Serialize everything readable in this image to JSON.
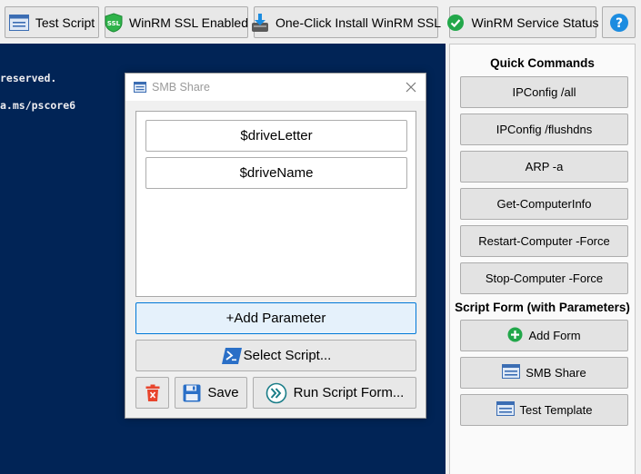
{
  "toolbar": {
    "test_script": "Test Script",
    "winrm_ssl_enabled": "WinRM SSL Enabled",
    "one_click_install": "One-Click Install WinRM SSL",
    "winrm_service_status": "WinRM Service Status",
    "help": "?"
  },
  "console": {
    "lines": [
      "reserved.",
      "a.ms/pscore6"
    ]
  },
  "right_panel": {
    "quick_commands_title": "Quick Commands",
    "quick_commands": [
      "IPConfig /all",
      "IPConfig /flushdns",
      "ARP -a",
      "Get-ComputerInfo",
      "Restart-Computer -Force",
      "Stop-Computer -Force"
    ],
    "script_form_title": "Script Form (with Parameters)",
    "add_form": "Add Form",
    "forms": [
      "SMB Share",
      "Test Template"
    ]
  },
  "dialog": {
    "title": "SMB Share",
    "parameters": [
      "$driveLetter",
      "$driveName"
    ],
    "add_parameter": "+Add Parameter",
    "select_script": "Select Script...",
    "save": "Save",
    "run_script_form": "Run Script Form..."
  },
  "colors": {
    "console_bg": "#012456",
    "accent_blue": "#0078d7",
    "green": "#22a74a",
    "delete_red": "#e8442c"
  },
  "icons": {
    "test_script": "form-window-icon",
    "winrm_ssl": "ssl-shield-icon",
    "one_click_install": "install-download-icon",
    "service_status": "check-circle-icon",
    "help": "help-icon",
    "add_form": "plus-circle-icon",
    "form": "form-window-icon",
    "select_script": "powershell-icon",
    "delete": "trash-icon",
    "save": "floppy-disk-icon",
    "run": "run-chevron-icon"
  }
}
